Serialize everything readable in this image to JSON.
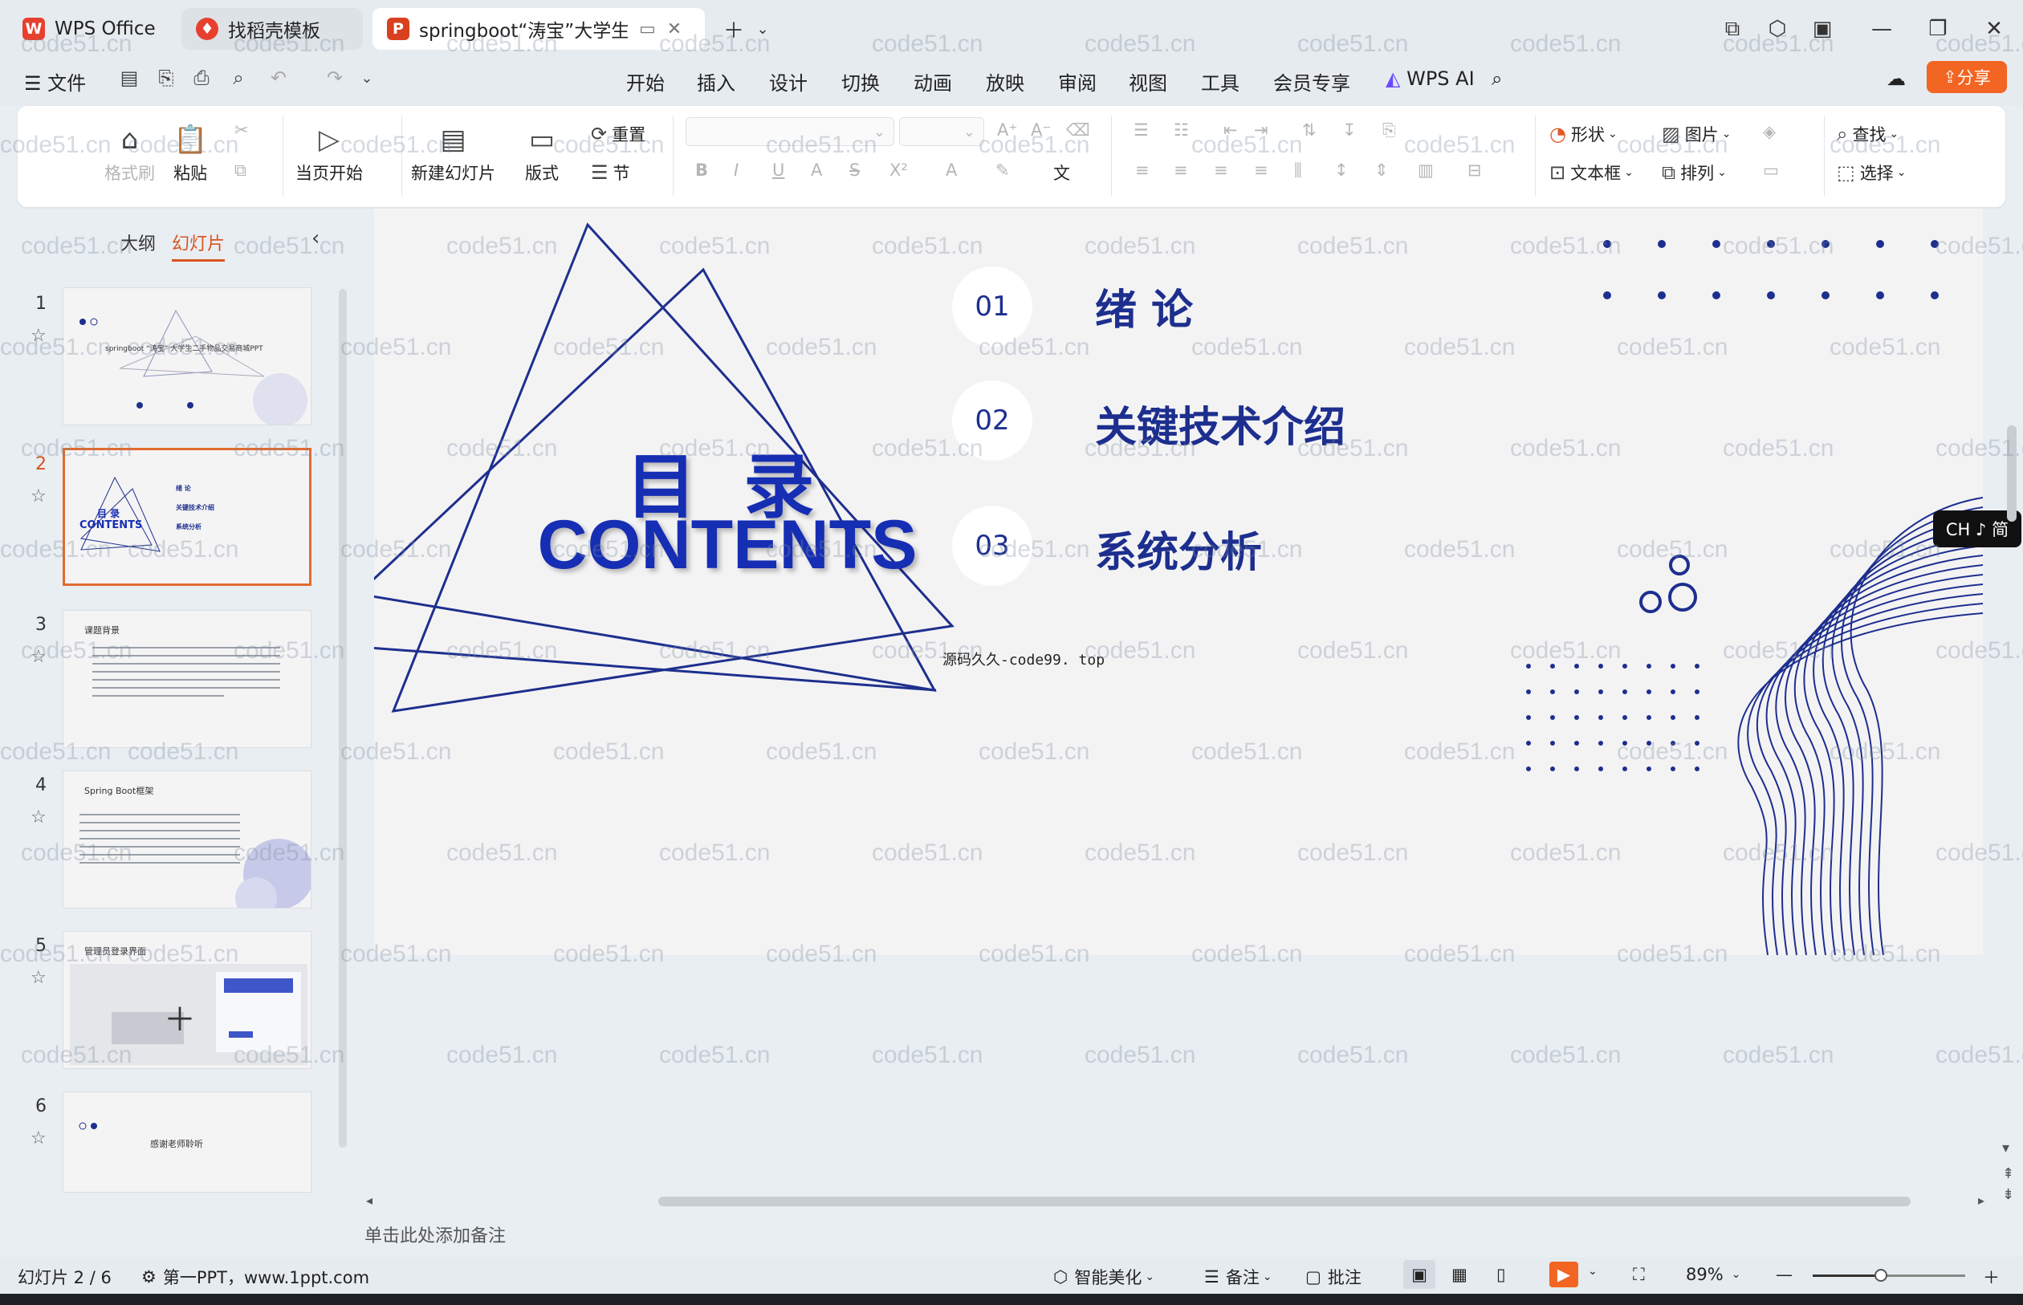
{
  "tabs": [
    {
      "label": "WPS Office",
      "icon": "wps-logo-icon"
    },
    {
      "label": "找稻壳模板",
      "icon": "docer-icon"
    },
    {
      "label": "springboot“涛宝”大学生二",
      "icon": "presentation-icon"
    }
  ],
  "menu": {
    "file": "文件",
    "items": [
      "开始",
      "插入",
      "设计",
      "切换",
      "动画",
      "放映",
      "审阅",
      "视图",
      "工具",
      "会员专享"
    ],
    "active": "开始",
    "wps_ai": "WPS AI",
    "share": "分享"
  },
  "ribbon": {
    "format_painter": "格式刷",
    "paste": "粘贴",
    "from_current": "当页开始",
    "new_slide": "新建幻灯片",
    "layout": "版式",
    "reset": "重置",
    "section": "节",
    "shape": "形状",
    "picture": "图片",
    "find": "查找",
    "textbox": "文本框",
    "arrange": "排列",
    "select": "选择"
  },
  "panel": {
    "tab_outline": "大纲",
    "tab_slides": "幻灯片",
    "slides": [
      {
        "num": "1",
        "title": "springboot “涛宝” 大学生二手物品交易商城PPT"
      },
      {
        "num": "2",
        "title": "目 录",
        "subtitle": "CONTENTS",
        "items": [
          "绪 论",
          "关键技术介绍",
          "系统分析"
        ]
      },
      {
        "num": "3",
        "title": "课题背景"
      },
      {
        "num": "4",
        "title": "Spring Boot框架"
      },
      {
        "num": "5",
        "title": "管理员登录界面"
      },
      {
        "num": "6",
        "title": "感谢老师聆听"
      }
    ],
    "active_slide": "2"
  },
  "slide": {
    "heading_cn": "目 录",
    "heading_en": "CONTENTS",
    "items": [
      {
        "num": "01",
        "title": "绪 论"
      },
      {
        "num": "02",
        "title": "关键技术介绍"
      },
      {
        "num": "03",
        "title": "系统分析"
      }
    ],
    "source_note": "源码久久-code99. top",
    "accent_color": "#1d2f8e"
  },
  "notes_placeholder": "单击此处添加备注",
  "ime": "CH ♪ 简",
  "status": {
    "slide_counter": "幻灯片 2 / 6",
    "template_credit": "第一PPT，www.1ppt.com",
    "beautify": "智能美化",
    "notes": "备注",
    "comments": "批注",
    "zoom": "89%"
  },
  "watermark_text": "code51.cn"
}
